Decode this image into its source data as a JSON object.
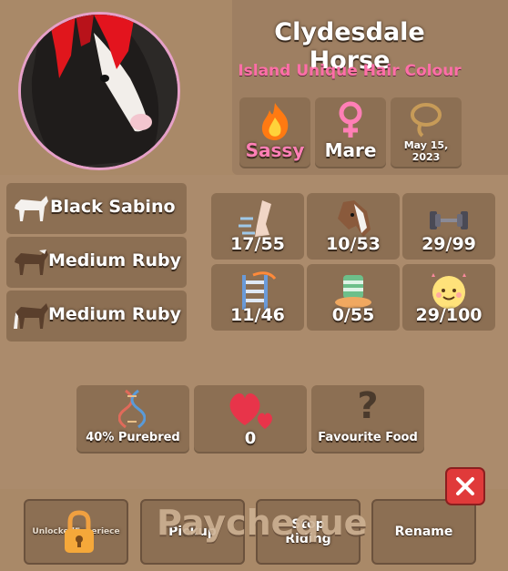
{
  "horse": {
    "name": "Clydesdale Horse",
    "subtitle": "Island Unique Hair Colour",
    "personality": "Sassy",
    "sex": "Mare",
    "birth_date": "May 15,\n2023"
  },
  "genes": [
    {
      "label": "Black Sabino"
    },
    {
      "label": "Medium Ruby"
    },
    {
      "label": "Medium Ruby"
    }
  ],
  "stats": [
    {
      "icon": "speed-leg-icon",
      "value": "17/55"
    },
    {
      "icon": "horse-head-icon",
      "value": "10/53"
    },
    {
      "icon": "dumbbell-icon",
      "value": "29/99"
    },
    {
      "icon": "jump-ladder-icon",
      "value": "11/46"
    },
    {
      "icon": "food-bowl-icon",
      "value": "0/55"
    },
    {
      "icon": "happy-sun-icon",
      "value": "29/100"
    }
  ],
  "info": {
    "purebred": "40% Purebred",
    "hearts": "0",
    "food": "Favourite Food"
  },
  "buttons": {
    "locked_label": "UnlockedExperiece",
    "pickup": "Pickup",
    "stop_riding": "Stop Riding",
    "rename": "Rename"
  },
  "overlay": "Paycheque",
  "colors": {
    "accent_pink": "#ff6fa8",
    "tile": "#8c6f53",
    "background": "#ab8b6c",
    "close_red": "#e03a3a"
  }
}
